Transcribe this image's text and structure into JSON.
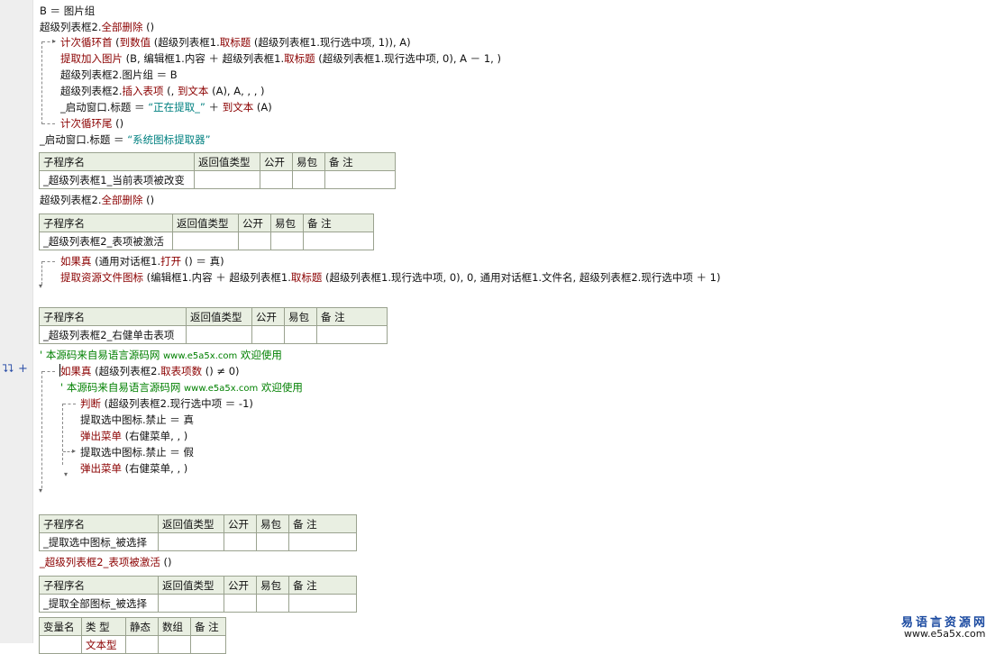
{
  "editor": {
    "l1": "B ＝ 图片组",
    "l2_obj": "超级列表框2.",
    "l2_kw": "全部删除",
    "l2_tail": " ()",
    "l3_kw": "计次循环首",
    "l3_a": " (",
    "l3_fn": "到数值",
    "l3_b": " (超级列表框1.",
    "l3_prop": "取标题",
    "l3_c": " (超级列表框1.现行选中项, 1)), A)",
    "l4_kw": "提取加入图片",
    "l4_a": " (B, 编辑框1.内容 ＋ 超级列表框1.",
    "l4_prop": "取标题",
    "l4_b": " (超级列表框1.现行选中项, 0), A － 1, )",
    "l5": "超级列表框2.图片组 ＝ B",
    "l6_a": "超级列表框2.",
    "l6_kw": "插入表项",
    "l6_b": " (, ",
    "l6_fn": "到文本",
    "l6_c": " (A), A, , , )",
    "l7_a": "_启动窗口.标题 ＝ ",
    "l7_str": "“正在提取_”",
    "l7_b": " ＋ ",
    "l7_fn": "到文本",
    "l7_c": " (A)",
    "l8_kw": "计次循环尾",
    "l8_tail": " ()",
    "l9_a": "_启动窗口.标题 ＝ ",
    "l9_str": "“系统图标提取器”",
    "l10_obj": "超级列表框2.",
    "l10_kw": "全部删除",
    "l10_tail": " ()",
    "l11_kw": "如果真",
    "l11_a": " (通用对话框1.",
    "l11_fn": "打开",
    "l11_b": " () ＝ 真)",
    "l12_kw": "提取资源文件图标",
    "l12_a": " (编辑框1.内容 ＋ 超级列表框1.",
    "l12_prop": "取标题",
    "l12_b": " (超级列表框1.现行选中项, 0), 0, 通用对话框1.文件名, 超级列表框2.现行选中项 ＋ 1)",
    "c1_a": "' 本源码来自易语言源码网 ",
    "c1_url": "www.e5a5x.com",
    "c1_b": " 欢迎使用",
    "l13_kw": "如果真",
    "l13_a": " (超级列表框2.",
    "l13_fn": "取表项数",
    "l13_b": " () ≠ 0)",
    "c2_a": "' 本源码来自易语言源码网 ",
    "c2_url": "www.e5a5x.com",
    "c2_b": " 欢迎使用",
    "l14_kw": "判断",
    "l14_a": " (超级列表框2.现行选中项 ＝ -1)",
    "l15": "提取选中图标.禁止 ＝ 真",
    "l16_kw": "弹出菜单",
    "l16_a": " (右健菜单, , )",
    "l17": "提取选中图标.禁止 ＝ 假",
    "l18_kw": "弹出菜单",
    "l18_a": " (右健菜单, , )",
    "l19_kw": "_超级列表框2_表项被激活",
    "l19_tail": " ()"
  },
  "table_headers": {
    "name": "子程序名",
    "ret": "返回值类型",
    "pub": "公开",
    "pack": "易包",
    "note": "备 注"
  },
  "subs": {
    "s1": "_超级列表框1_当前表项被改变",
    "s2": "_超级列表框2_表项被激活",
    "s3": "_超级列表框2_右健单击表项",
    "s4": "_提取选中图标_被选择",
    "s5": "_提取全部图标_被选择"
  },
  "var_headers": {
    "name": "变量名",
    "type": "类 型",
    "static": "静态",
    "array": "数组",
    "note": "备 注"
  },
  "var_row": {
    "type": "文本型"
  },
  "watermark": {
    "title": "易语言资源网",
    "url": "www.e5a5x.com"
  },
  "colors": {
    "keyword": "#8b0000",
    "comment": "#008000",
    "string": "#008080",
    "table_header": "#e9efe2"
  }
}
